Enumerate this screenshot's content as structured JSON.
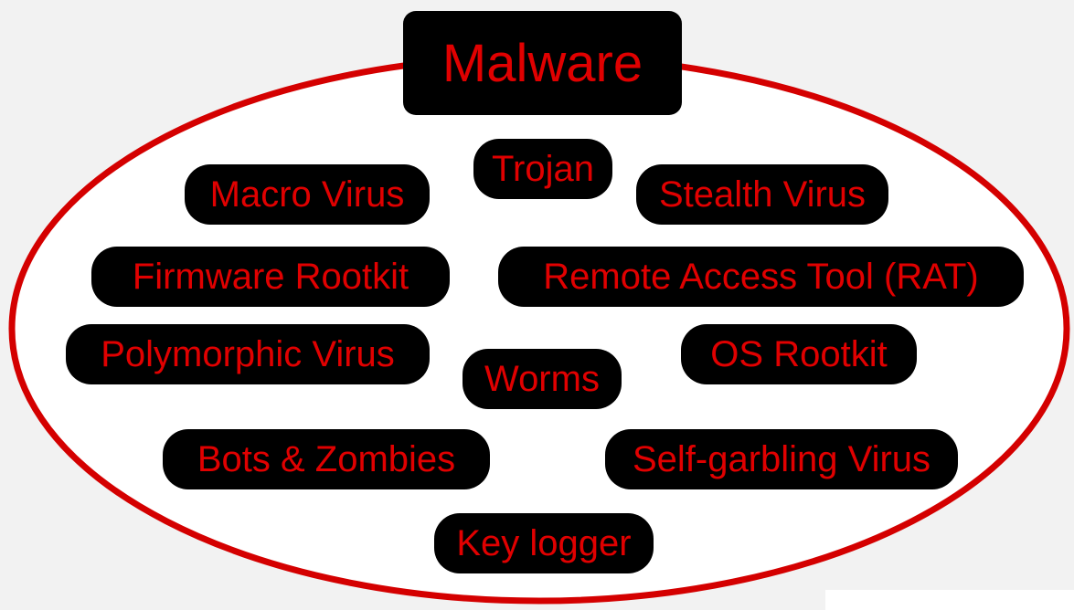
{
  "title": "Malware",
  "colors": {
    "accent": "#e00000",
    "node_fill": "#000000",
    "background": "#f2f2f2"
  },
  "items": [
    "Trojan",
    "Macro Virus",
    "Stealth Virus",
    "Firmware Rootkit",
    "Remote Access Tool (RAT)",
    "Polymorphic Virus",
    "Worms",
    "OS Rootkit",
    "Bots & Zombies",
    "Self-garbling Virus",
    "Key logger"
  ]
}
